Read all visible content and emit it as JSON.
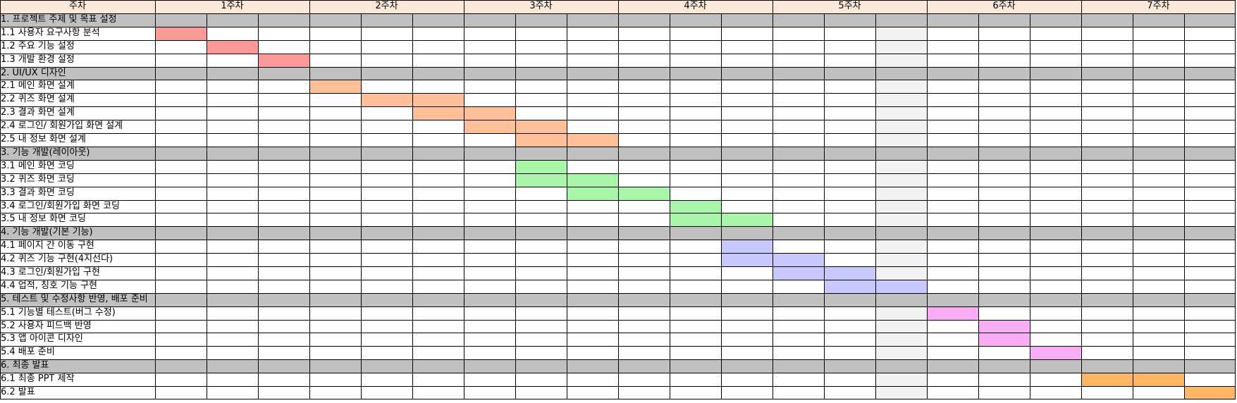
{
  "header": {
    "first_col_label": "주차",
    "weeks": [
      "1주차",
      "2주차",
      "3주차",
      "4주차",
      "5주차",
      "6주차",
      "7주차"
    ]
  },
  "colors": {
    "header_bg": "#fde9d9",
    "section_bg": "#c0c0c0",
    "gap_column": "#f2f2f2",
    "task_colors": [
      "#ff9999",
      "#ffc099",
      "#a9f5a9",
      "#c8c8ff",
      "#f9adf5",
      "#ffb766"
    ]
  },
  "rows": [
    {
      "type": "section",
      "label": "1. 프로젝트 주제 및 목표 설정"
    },
    {
      "type": "task",
      "label": "1.1 사용자 요구사항 분석",
      "group": 0,
      "start": 0,
      "end": 0
    },
    {
      "type": "task",
      "label": "1.2 주요 기능 설정",
      "group": 0,
      "start": 1,
      "end": 1
    },
    {
      "type": "task",
      "label": "1.3 개발 환경 설정",
      "group": 0,
      "start": 2,
      "end": 2
    },
    {
      "type": "section",
      "label": "2.  UI/UX 디자인"
    },
    {
      "type": "task",
      "label": "2.1 메인 화면 설계",
      "group": 1,
      "start": 3,
      "end": 3
    },
    {
      "type": "task",
      "label": "2.2 퀴즈 화면 설계",
      "group": 1,
      "start": 4,
      "end": 5
    },
    {
      "type": "task",
      "label": "2.3 결과 화면 설계",
      "group": 1,
      "start": 5,
      "end": 6
    },
    {
      "type": "task",
      "label": "2.4 로그인/ 회원가입 화면 설계",
      "group": 1,
      "start": 6,
      "end": 7
    },
    {
      "type": "task",
      "label": "2.5 내 정보 화면 설계",
      "group": 1,
      "start": 7,
      "end": 8
    },
    {
      "type": "section",
      "label": "3. 기능 개발(레이아웃)"
    },
    {
      "type": "task",
      "label": "3.1 메인 화면 코딩",
      "group": 2,
      "start": 7,
      "end": 7
    },
    {
      "type": "task",
      "label": "3.2 퀴즈 화면 코딩",
      "group": 2,
      "start": 7,
      "end": 8
    },
    {
      "type": "task",
      "label": "3.3 결과 화면 코딩",
      "group": 2,
      "start": 8,
      "end": 9
    },
    {
      "type": "task",
      "label": "3.4 로그인/회원가입 화면 코딩",
      "group": 2,
      "start": 10,
      "end": 10
    },
    {
      "type": "task",
      "label": "3.5 내 정보 화면 코딩",
      "group": 2,
      "start": 10,
      "end": 11
    },
    {
      "type": "section",
      "label": "4. 기능 개발(기본 기능)"
    },
    {
      "type": "task",
      "label": "4.1 페이지 간 이동 구현",
      "group": 3,
      "start": 11,
      "end": 11
    },
    {
      "type": "task",
      "label": "4.2 퀴즈 기능 구현(4지선다)",
      "group": 3,
      "start": 11,
      "end": 12
    },
    {
      "type": "task",
      "label": "4.3 로그인/회원가입 구현",
      "group": 3,
      "start": 12,
      "end": 13
    },
    {
      "type": "task",
      "label": "4.4 업적, 칭호 기능 구현",
      "group": 3,
      "start": 13,
      "end": 14
    },
    {
      "type": "section",
      "label": "5. 테스트 및 수정사항 반영, 배포 준비"
    },
    {
      "type": "task",
      "label": "5.1 기능별 테스트(버그 수정)",
      "group": 4,
      "start": 15,
      "end": 15
    },
    {
      "type": "task",
      "label": "5.2 사용자 피드백 반영",
      "group": 4,
      "start": 16,
      "end": 16
    },
    {
      "type": "task",
      "label": "5.3 앱 아이콘 디자인",
      "group": 4,
      "start": 16,
      "end": 16
    },
    {
      "type": "task",
      "label": "5.4 배포 준비",
      "group": 4,
      "start": 17,
      "end": 17
    },
    {
      "type": "section",
      "label": "6. 최종 발표"
    },
    {
      "type": "task",
      "label": "6.1 최종 PPT 제작",
      "group": 5,
      "start": 18,
      "end": 19
    },
    {
      "type": "task",
      "label": "6.2 발표",
      "group": 5,
      "start": 20,
      "end": 20
    }
  ]
}
